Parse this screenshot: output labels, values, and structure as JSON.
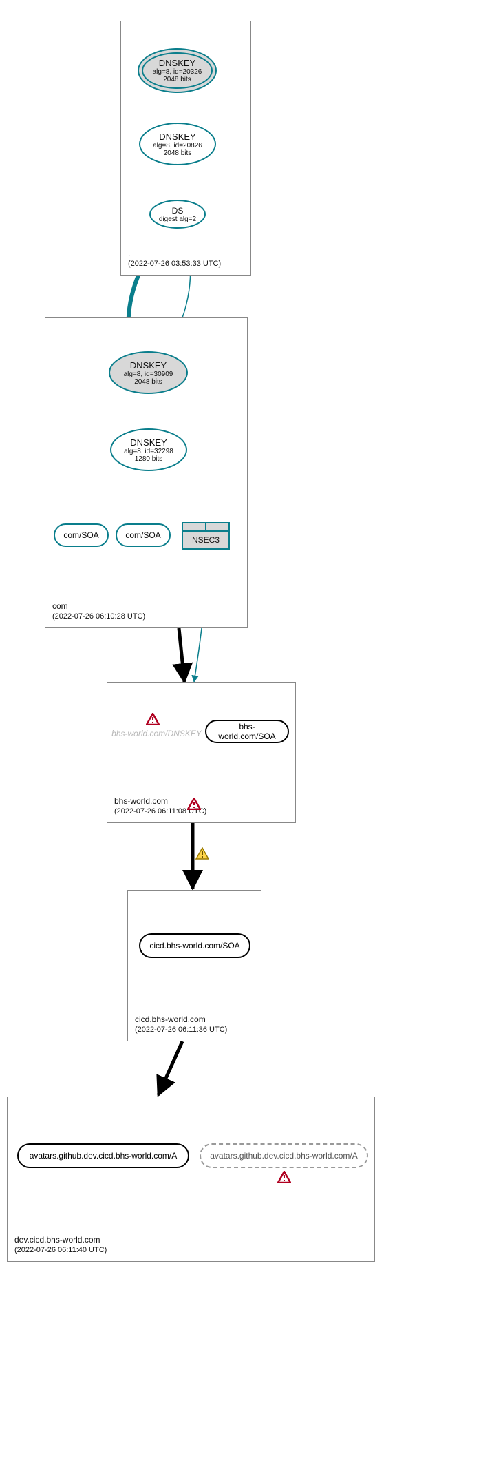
{
  "zones": {
    "root": {
      "name": ".",
      "timestamp": "(2022-07-26 03:53:33 UTC)"
    },
    "com": {
      "name": "com",
      "timestamp": "(2022-07-26 06:10:28 UTC)"
    },
    "bhsworld": {
      "name": "bhs-world.com",
      "timestamp": "(2022-07-26 06:11:08 UTC)"
    },
    "cicd": {
      "name": "cicd.bhs-world.com",
      "timestamp": "(2022-07-26 06:11:36 UTC)"
    },
    "dev": {
      "name": "dev.cicd.bhs-world.com",
      "timestamp": "(2022-07-26 06:11:40 UTC)"
    }
  },
  "nodes": {
    "root_ksk": {
      "title": "DNSKEY",
      "line2": "alg=8, id=20326",
      "line3": "2048 bits"
    },
    "root_zsk": {
      "title": "DNSKEY",
      "line2": "alg=8, id=20826",
      "line3": "2048 bits"
    },
    "root_ds": {
      "title": "DS",
      "line2": "digest alg=2"
    },
    "com_ksk": {
      "title": "DNSKEY",
      "line2": "alg=8, id=30909",
      "line3": "2048 bits"
    },
    "com_zsk": {
      "title": "DNSKEY",
      "line2": "alg=8, id=32298",
      "line3": "1280 bits"
    },
    "com_soa1": {
      "label": "com/SOA"
    },
    "com_soa2": {
      "label": "com/SOA"
    },
    "com_nsec3": {
      "label": "NSEC3"
    },
    "bhs_dnskey_ghost": {
      "label": "bhs-world.com/DNSKEY"
    },
    "bhs_soa": {
      "label": "bhs-world.com/SOA"
    },
    "cicd_soa": {
      "label": "cicd.bhs-world.com/SOA"
    },
    "dev_a1": {
      "label": "avatars.github.dev.cicd.bhs-world.com/A"
    },
    "dev_a2": {
      "label": "avatars.github.dev.cicd.bhs-world.com/A"
    }
  }
}
